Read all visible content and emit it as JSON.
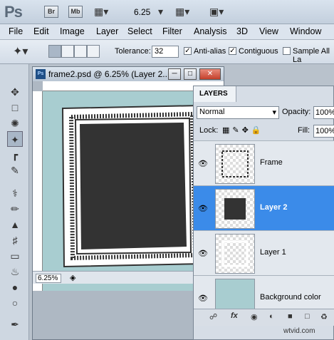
{
  "app": {
    "logo": "Ps",
    "bridge_label": "Br",
    "minibridge_label": "Mb",
    "zoom_value": "6.25"
  },
  "menu": [
    "File",
    "Edit",
    "Image",
    "Layer",
    "Select",
    "Filter",
    "Analysis",
    "3D",
    "View",
    "Window"
  ],
  "options": {
    "tolerance_label": "Tolerance:",
    "tolerance_value": "32",
    "antialias_label": "Anti-alias",
    "contiguous_label": "Contiguous",
    "sample_all_label": "Sample All La"
  },
  "document": {
    "title": "frame2.psd @ 6.25% (Layer 2...",
    "zoom_status": "6.25%",
    "badge": "Ps"
  },
  "layers_panel": {
    "tab_label": "LAYERS",
    "blend_mode": "Normal",
    "opacity_label": "Opacity:",
    "opacity_value": "100%",
    "lock_label": "Lock:",
    "fill_label": "Fill:",
    "fill_value": "100%",
    "layers": [
      {
        "name": "Frame",
        "selected": false
      },
      {
        "name": "Layer 2",
        "selected": true
      },
      {
        "name": "Layer 1",
        "selected": false
      },
      {
        "name": "Background color",
        "selected": false
      }
    ],
    "footer_icons": [
      "link-icon",
      "fx-icon",
      "mask-icon",
      "adjustment-icon",
      "group-icon",
      "new-layer-icon",
      "trash-icon"
    ],
    "fx_label": "fx"
  },
  "watermark": "wtvid.com",
  "colors": {
    "selected_layer": "#3b8be9",
    "canvas_bg": "#a8cdd0",
    "frame_dark": "#333333"
  }
}
